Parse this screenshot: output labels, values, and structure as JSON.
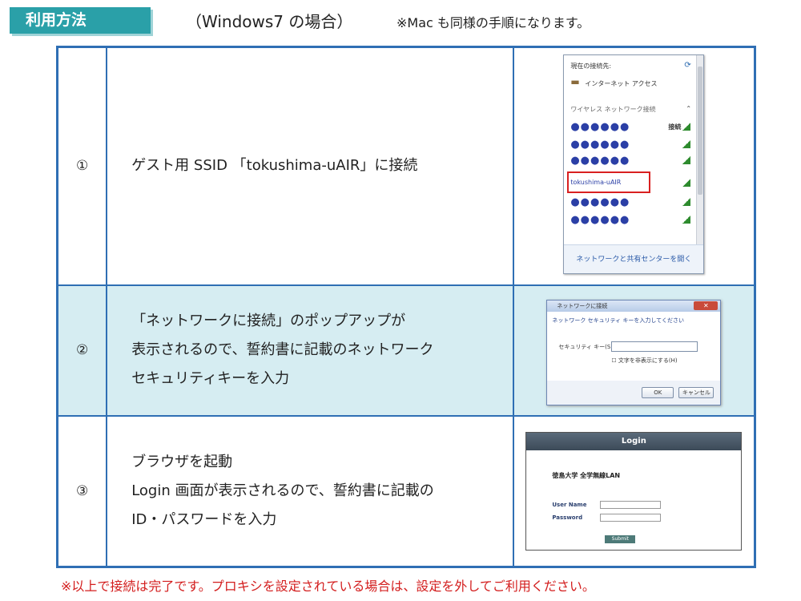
{
  "header": {
    "tag": "利用方法",
    "subtitle": "（Windows7 の場合）",
    "note": "※Mac も同様の手順になります。"
  },
  "steps": [
    {
      "num": "①",
      "lines": [
        "ゲスト用 SSID 「tokushima-uAIR」に接続"
      ]
    },
    {
      "num": "②",
      "lines": [
        "「ネットワークに接続」のポップアップが",
        "表示されるので、誓約書に記載のネットワーク",
        "セキュリティキーを入力"
      ]
    },
    {
      "num": "③",
      "lines": [
        "ブラウザを起動",
        "Login 画面が表示されるので、誓約書に記載の",
        "ID・パスワードを入力"
      ]
    }
  ],
  "network_window": {
    "current": "現在の接続先:",
    "internet": "インターネット アクセス",
    "wireless": "ワイヤレス ネットワーク接続",
    "connected": "接続",
    "hidden": "●●●●●●",
    "ssid": "tokushima-uAIR",
    "footer": "ネットワークと共有センターを開く"
  },
  "dialog": {
    "title": "ネットワークに接続",
    "prompt": "ネットワーク セキュリティ キーを入力してください",
    "key_label": "セキュリティ キー(S):",
    "show_chars": "文字を非表示にする(H)",
    "ok": "OK",
    "cancel": "キャンセル"
  },
  "login": {
    "title": "Login",
    "heading": "徳島大学 全学無線LAN",
    "user_label": "User Name",
    "pass_label": "Password",
    "submit": "Submit"
  },
  "footer_note": "※以上で接続は完了です。プロキシを設定されている場合は、設定を外してご利用ください。",
  "colors": {
    "accent": "#2aa0a8",
    "border": "#2f6fb4",
    "row_highlight": "#d6edf2",
    "warning": "#d31d1d"
  }
}
